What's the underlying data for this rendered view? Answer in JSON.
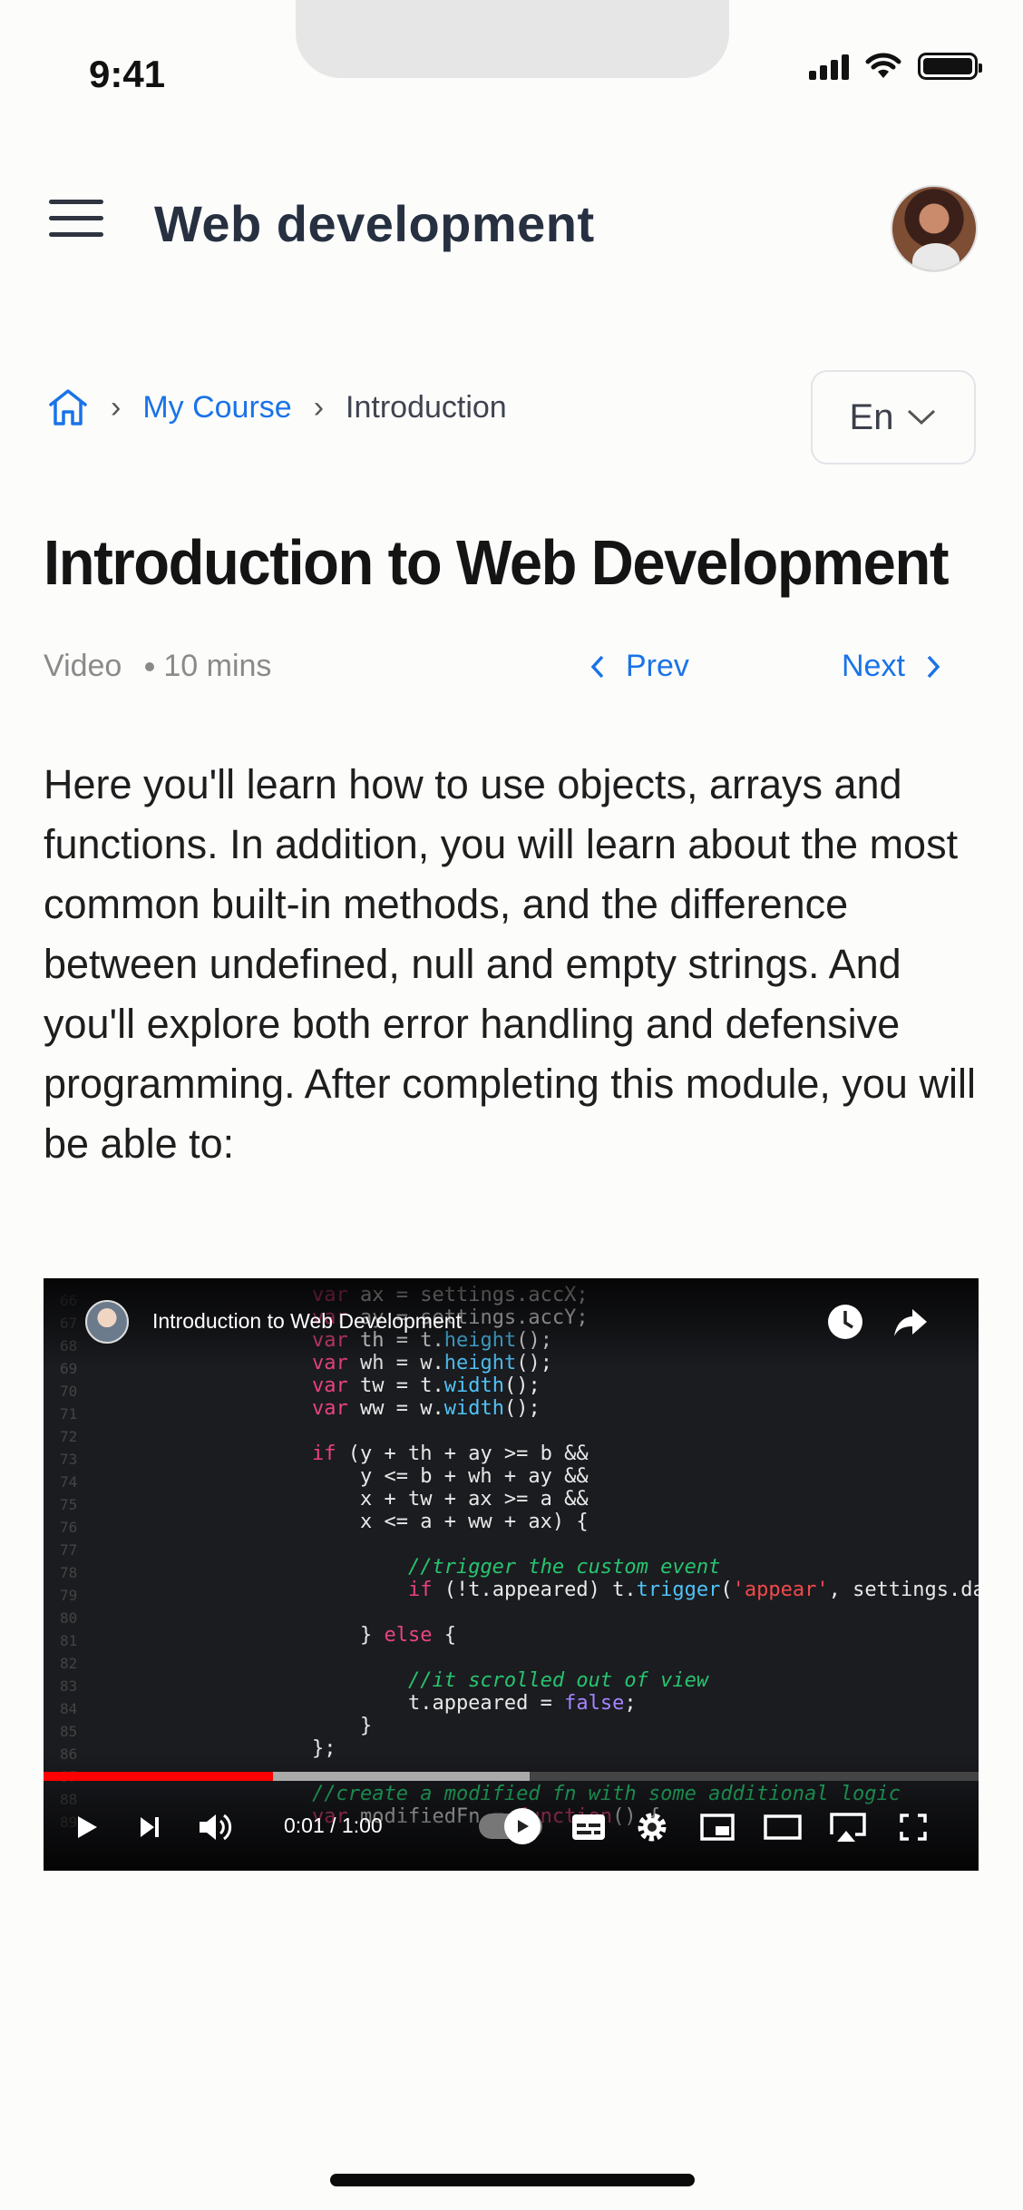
{
  "status_bar": {
    "time": "9:41"
  },
  "header": {
    "title": "Web development",
    "menu_icon": "hamburger-menu-icon",
    "avatar_icon": "user-avatar"
  },
  "breadcrumb": {
    "home_icon": "home-icon",
    "items": [
      "My Course",
      "Introduction"
    ]
  },
  "language": {
    "selected": "En"
  },
  "lesson": {
    "title": "Introduction to Web Development",
    "type": "Video",
    "duration": "10 mins",
    "prev_label": "Prev",
    "next_label": "Next",
    "description": "Here you'll learn how to use objects, arrays and functions. In addition, you will learn about the most common built-in methods, and the difference between undefined, null and empty strings. And you'll explore both error handling and defensive programming. After completing this module, you will be able to:"
  },
  "video": {
    "title": "Introduction to Web Development",
    "time": "0:01 / 1:00",
    "progress_played": 0.245,
    "progress_buffered": 0.52,
    "code_lines": [
      "var ax = settings.accX;",
      "var ay = settings.accY;",
      "var th = t.height();",
      "var wh = w.height();",
      "var tw = t.width();",
      "var ww = w.width();",
      "",
      "if (y + th + ay >= b &&",
      "    y <= b + wh + ay &&",
      "    x + tw + ax >= a &&",
      "    x <= a + ww + ax) {",
      "",
      "        //trigger the custom event",
      "        if (!t.appeared) t.trigger('appear', settings.data);",
      "",
      "    } else {",
      "",
      "        //it scrolled out of view",
      "        t.appeared = false;",
      "    }",
      "};",
      "",
      "//create a modified fn with some additional logic",
      "var modifiedFn = function() {"
    ]
  }
}
